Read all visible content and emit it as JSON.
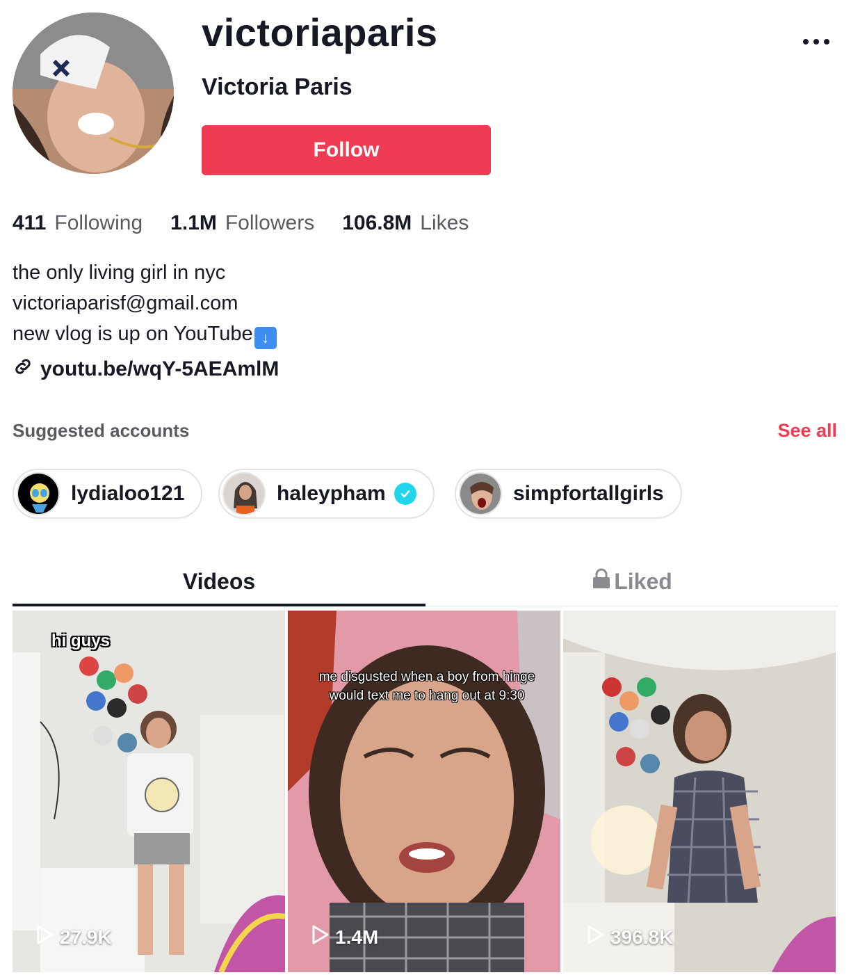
{
  "profile": {
    "username": "victoriaparis",
    "nickname": "Victoria Paris",
    "follow_label": "Follow",
    "stats": [
      {
        "value": "411",
        "label": "Following"
      },
      {
        "value": "1.1M",
        "label": "Followers"
      },
      {
        "value": "106.8M",
        "label": "Likes"
      }
    ],
    "bio": [
      "the only living girl in nyc",
      "victoriaparisf@gmail.com",
      "new vlog is up on YouTube"
    ],
    "link": "youtu.be/wqY-5AEAmlM"
  },
  "suggested": {
    "title": "Suggested accounts",
    "see_all": "See all",
    "accounts": [
      {
        "name": "lydialoo121",
        "verified": false
      },
      {
        "name": "haleypham",
        "verified": true
      },
      {
        "name": "simpfortallgirls",
        "verified": false
      }
    ]
  },
  "tabs": {
    "videos": "Videos",
    "liked": "Liked"
  },
  "videos": [
    {
      "caption": "hi guys",
      "plays": "27.9K"
    },
    {
      "caption": "me disgusted when a boy from hinge would text me to hang out at 9:30",
      "plays": "1.4M"
    },
    {
      "caption": "",
      "plays": "396.8K"
    }
  ],
  "colors": {
    "accent": "#ef3b53",
    "verified": "#20d5ec",
    "text": "#161823",
    "secondary": "#5a5b61"
  }
}
